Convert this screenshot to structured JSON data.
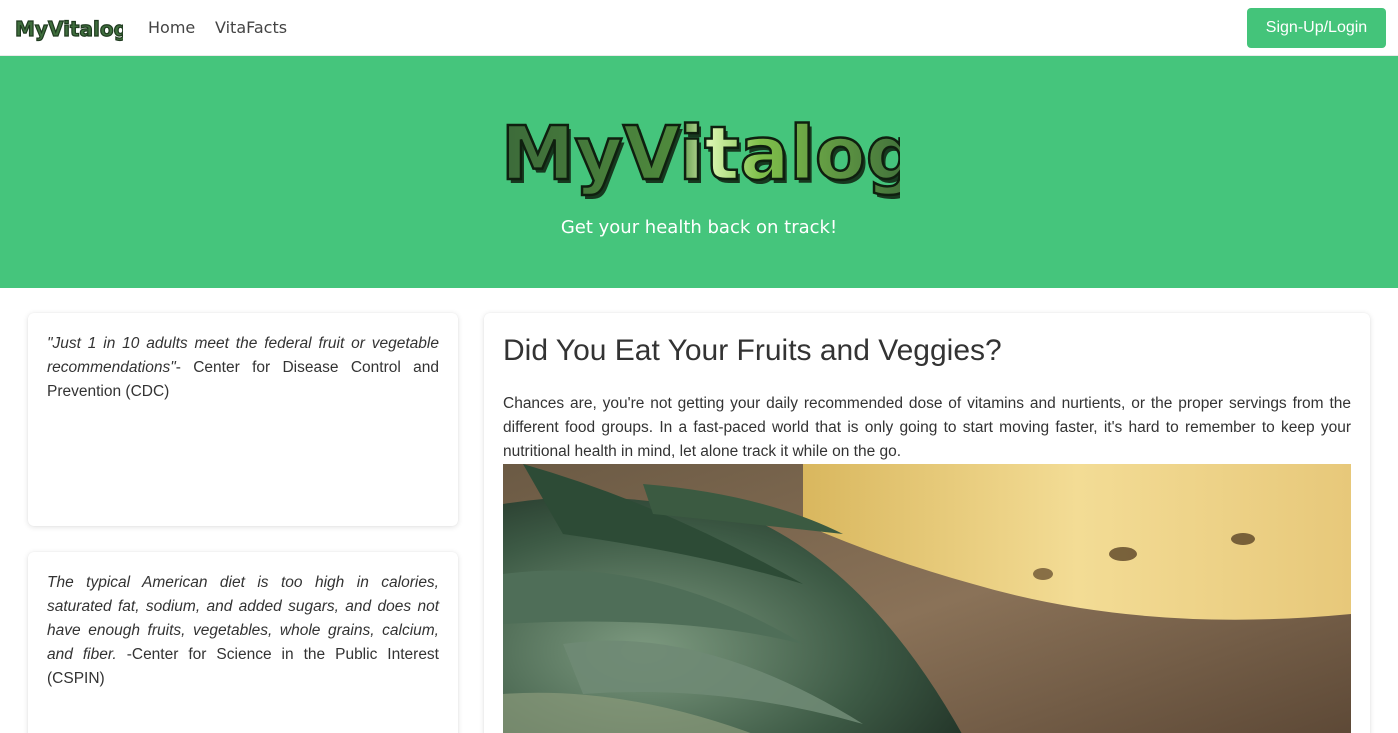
{
  "nav": {
    "brand": "MyVitalog",
    "links": [
      "Home",
      "VitaFacts"
    ],
    "signup_label": "Sign-Up/Login"
  },
  "hero": {
    "logo_text": "MyVitalog",
    "tagline": "Get your health back on track!"
  },
  "quotes": [
    {
      "quote": "\"Just 1 in 10 adults meet the federal fruit or vegetable recommendations\"",
      "source": "- Center for Disease Control and Prevention (CDC)"
    },
    {
      "quote": "The typical American diet is too high in calories, saturated fat, sodium, and added sugars, and does not have enough fruits, vegetables, whole grains, calcium, and fiber.",
      "source": " -Center for Science in the Public Interest (CSPIN)"
    }
  ],
  "main": {
    "title": "Did You Eat Your Fruits and Veggies?",
    "body": "Chances are, you're not getting your daily recommended dose of vitamins and nurtients, or the proper servings from the different food groups. In a fast-paced world that is only going to start moving faster, it's hard to remember to keep your nutritional health in mind, let alone track it while on the go."
  },
  "colors": {
    "brand_green": "#45c57c",
    "button_green": "#44c47a",
    "logo_dark_green": "#3f6e3d"
  },
  "icons": {
    "photo": "pineapple-photo"
  }
}
